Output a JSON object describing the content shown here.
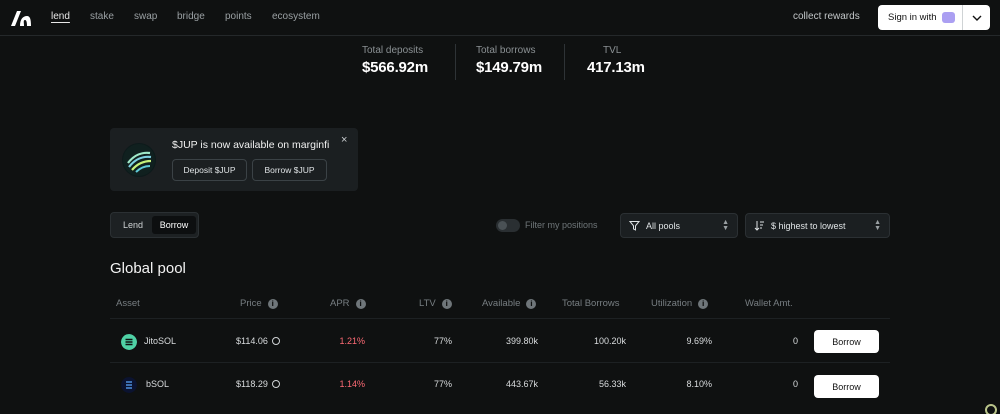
{
  "nav": {
    "links": [
      "lend",
      "stake",
      "swap",
      "bridge",
      "points",
      "ecosystem"
    ],
    "collect_rewards": "collect rewards",
    "sign_in": "Sign in with"
  },
  "stats": [
    {
      "label": "Total deposits",
      "value": "$566.92m"
    },
    {
      "label": "Total borrows",
      "value": "$149.79m"
    },
    {
      "label": "TVL",
      "value": "417.13m"
    }
  ],
  "banner": {
    "title": "$JUP is now available on marginfi",
    "close": "×",
    "deposit_label": "Deposit $JUP",
    "borrow_label": "Borrow $JUP"
  },
  "toggle": {
    "lend": "Lend",
    "borrow": "Borrow"
  },
  "filters": {
    "my_positions": "Filter my positions",
    "pools": "All pools",
    "sort": "$ highest to lowest"
  },
  "pool": {
    "title": "Global pool",
    "columns": {
      "asset": "Asset",
      "price": "Price",
      "apr": "APR",
      "ltv": "LTV",
      "available": "Available",
      "total_borrows": "Total Borrows",
      "utilization": "Utilization",
      "wallet": "Wallet Amt."
    },
    "rows": [
      {
        "asset": "JitoSOL",
        "price": "$114.06",
        "apr": "1.21%",
        "ltv": "77%",
        "available": "399.80k",
        "total_borrows": "100.20k",
        "utilization": "9.69%",
        "wallet": "0",
        "action": "Borrow"
      },
      {
        "asset": "bSOL",
        "price": "$118.29",
        "apr": "1.14%",
        "ltv": "77%",
        "available": "443.67k",
        "total_borrows": "56.33k",
        "utilization": "8.10%",
        "wallet": "0",
        "action": "Borrow"
      }
    ]
  },
  "colors": {
    "background": "#0f1111",
    "apr_red": "#ff6b75",
    "panel": "#1b1f21"
  },
  "icons": [
    "marginfi-logo-icon",
    "phantom-icon",
    "chevron-down-icon",
    "jup-icon",
    "close-icon",
    "filter-icon",
    "sort-icon",
    "info-icon",
    "jitosol-icon",
    "bsol-icon",
    "pyth-icon"
  ]
}
